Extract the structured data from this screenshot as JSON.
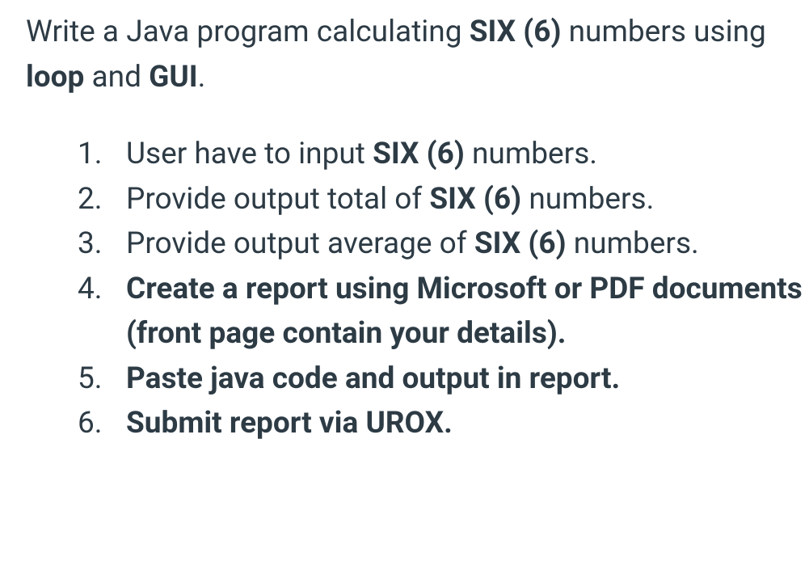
{
  "intro": {
    "part1": "Write a Java program calculating ",
    "bold1": "SIX (6)",
    "part2": " numbers using ",
    "bold2": "loop",
    "part3": " and ",
    "bold3": "GUI",
    "part4": "."
  },
  "items": [
    {
      "segments": [
        {
          "text": "User have to input ",
          "bold": false
        },
        {
          "text": "SIX (6)",
          "bold": true
        },
        {
          "text": " numbers.",
          "bold": false
        }
      ]
    },
    {
      "segments": [
        {
          "text": "Provide output total of ",
          "bold": false
        },
        {
          "text": "SIX (6)",
          "bold": true
        },
        {
          "text": " numbers.",
          "bold": false
        }
      ]
    },
    {
      "segments": [
        {
          "text": "Provide output average of ",
          "bold": false
        },
        {
          "text": "SIX (6)",
          "bold": true
        },
        {
          "text": " numbers.",
          "bold": false
        }
      ]
    },
    {
      "segments": [
        {
          "text": "Create a report using Microsoft or PDF documents (front page contain your details).",
          "bold": true
        }
      ]
    },
    {
      "segments": [
        {
          "text": "Paste java code and output in report.",
          "bold": true
        }
      ]
    },
    {
      "segments": [
        {
          "text": "Submit report via UROX.",
          "bold": true
        }
      ]
    }
  ]
}
